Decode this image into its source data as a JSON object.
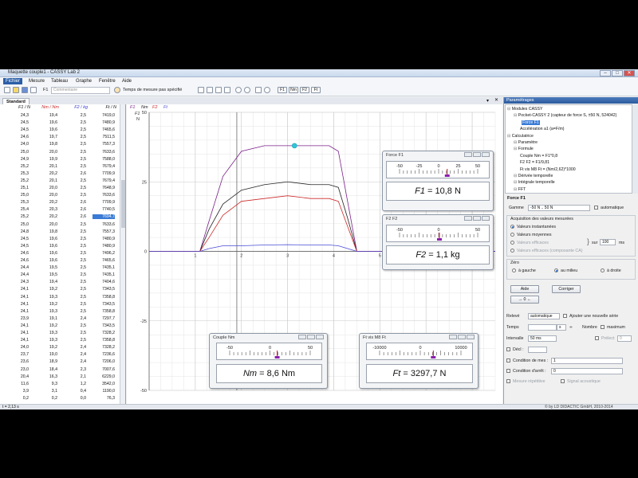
{
  "window": {
    "title": "Maquette couple1 - CASSY Lab 2",
    "min": "–",
    "max": "□",
    "close": "✕"
  },
  "menu": [
    "Fichier",
    "Mesure",
    "Tableau",
    "Graphe",
    "Fenêtre",
    "Aide"
  ],
  "toolbar": {
    "counter": "F1",
    "comment_placeholder": "Commentaire",
    "measure_time": "Temps de mesure pas spécifié",
    "quantity_buttons": [
      "F1",
      "Nm",
      "F2",
      "Ft"
    ]
  },
  "tab": "Standard",
  "table": {
    "headers": [
      "F1 / N",
      "Nm / Nm",
      "F2 / kg",
      "Ft / N"
    ],
    "rows": [
      [
        "24,3",
        "19,4",
        "2,5",
        "7419,0"
      ],
      [
        "24,5",
        "19,6",
        "2,5",
        "7480,9"
      ],
      [
        "24,5",
        "19,6",
        "2,5",
        "7465,6"
      ],
      [
        "24,6",
        "19,7",
        "2,5",
        "7511,5"
      ],
      [
        "24,0",
        "19,8",
        "2,5",
        "7557,3"
      ],
      [
        "25,0",
        "20,0",
        "2,5",
        "7633,6"
      ],
      [
        "24,9",
        "19,9",
        "2,5",
        "7588,0"
      ],
      [
        "25,2",
        "20,1",
        "2,5",
        "7679,4"
      ],
      [
        "25,3",
        "20,2",
        "2,6",
        "7709,9"
      ],
      [
        "25,2",
        "20,1",
        "2,5",
        "7679,4"
      ],
      [
        "25,1",
        "20,0",
        "2,5",
        "7648,9"
      ],
      [
        "25,0",
        "20,0",
        "2,5",
        "7633,6"
      ],
      [
        "25,3",
        "20,2",
        "2,6",
        "7709,9"
      ],
      [
        "25,4",
        "20,3",
        "2,6",
        "7740,5"
      ],
      [
        "25,2",
        "20,2",
        "2,6",
        "7694,7"
      ],
      [
        "25,0",
        "20,0",
        "2,5",
        "7633,6"
      ],
      [
        "24,8",
        "19,8",
        "2,5",
        "7557,3"
      ],
      [
        "24,5",
        "19,6",
        "2,5",
        "7480,9"
      ],
      [
        "24,5",
        "19,6",
        "2,5",
        "7480,9"
      ],
      [
        "24,6",
        "19,6",
        "2,5",
        "7496,2"
      ],
      [
        "24,6",
        "19,6",
        "2,5",
        "7465,6"
      ],
      [
        "24,4",
        "19,5",
        "2,5",
        "7435,1"
      ],
      [
        "24,4",
        "19,5",
        "2,5",
        "7435,1"
      ],
      [
        "24,3",
        "19,4",
        "2,5",
        "7404,6"
      ],
      [
        "24,1",
        "19,2",
        "2,5",
        "7343,5"
      ],
      [
        "24,1",
        "19,3",
        "2,5",
        "7358,8"
      ],
      [
        "24,1",
        "19,2",
        "2,5",
        "7343,5"
      ],
      [
        "24,1",
        "19,3",
        "2,5",
        "7358,8"
      ],
      [
        "23,9",
        "19,1",
        "2,4",
        "7297,7"
      ],
      [
        "24,1",
        "19,2",
        "2,5",
        "7343,5"
      ],
      [
        "24,1",
        "19,3",
        "2,5",
        "7328,2"
      ],
      [
        "24,1",
        "19,3",
        "2,5",
        "7358,8"
      ],
      [
        "24,0",
        "19,2",
        "2,4",
        "7328,2"
      ],
      [
        "23,7",
        "19,0",
        "2,4",
        "7236,6"
      ],
      [
        "23,6",
        "18,9",
        "2,4",
        "7206,0"
      ],
      [
        "23,0",
        "18,4",
        "2,3",
        "7007,6"
      ],
      [
        "20,4",
        "16,3",
        "2,1",
        "6229,0"
      ],
      [
        "11,6",
        "9,3",
        "1,2",
        "3542,0"
      ],
      [
        "3,9",
        "3,1",
        "0,4",
        "1190,0"
      ],
      [
        "0,2",
        "0,2",
        "0,0",
        "76,3"
      ]
    ],
    "selected_row": 14
  },
  "chart": {
    "legend": [
      "F1",
      "Nm",
      "F2",
      "Ft"
    ],
    "y_unit": "F1\nN",
    "x_unit": "t / s",
    "colors": {
      "F1": "#7b1f8a",
      "Nm": "#222222",
      "F2": "#cc2a2a",
      "Ft": "#4a4ad6"
    }
  },
  "chart_data": {
    "type": "line",
    "xlabel": "t / s",
    "ylabel": "F1 / N",
    "xlim": [
      0,
      7.5
    ],
    "ylim": [
      -50,
      50
    ],
    "x_ticks": [
      0,
      1,
      2,
      3,
      4,
      5,
      6,
      7
    ],
    "y_ticks": [
      -50,
      -25,
      0,
      25,
      50
    ],
    "grid": true,
    "legend": "top-left",
    "series": [
      {
        "name": "F1",
        "x": [
          0,
          1.1,
          1.3,
          1.6,
          2.0,
          2.5,
          3.0,
          3.5,
          3.9,
          4.1,
          4.3,
          4.5,
          7.5
        ],
        "y": [
          0,
          0,
          11,
          27,
          36,
          38,
          38,
          38,
          38,
          36,
          18,
          0,
          0
        ]
      },
      {
        "name": "Nm",
        "x": [
          0,
          1.1,
          1.3,
          1.6,
          2.0,
          2.5,
          3.0,
          3.5,
          3.9,
          4.1,
          4.3,
          4.5,
          7.5
        ],
        "y": [
          0,
          0,
          8,
          17,
          22,
          24,
          25,
          24,
          24,
          23,
          12,
          0,
          0
        ]
      },
      {
        "name": "F2",
        "x": [
          0,
          1.1,
          1.3,
          1.6,
          2.0,
          2.5,
          3.0,
          3.5,
          3.9,
          4.1,
          4.3,
          4.5,
          7.5
        ],
        "y": [
          0,
          0,
          5,
          13,
          18,
          19,
          20,
          19,
          19,
          18,
          9,
          0,
          0
        ]
      },
      {
        "name": "Ft",
        "x": [
          0,
          1.1,
          1.3,
          1.6,
          2.0,
          2.5,
          3.0,
          3.5,
          3.9,
          4.1,
          4.3,
          4.5,
          7.5
        ],
        "y": [
          0,
          0,
          1,
          2,
          2,
          2.3,
          2.4,
          2.3,
          2.3,
          2,
          1,
          0,
          0
        ]
      }
    ]
  },
  "instruments": [
    {
      "title": "Force F1",
      "ticks": [
        "-50",
        "-25",
        "0",
        "25",
        "50"
      ],
      "label": "F1",
      "value": "10,8 N",
      "needle": 0.61
    },
    {
      "title": "F2 F2",
      "ticks": [
        "-50",
        "0",
        "50"
      ],
      "label": "F2",
      "value": "1,1 kg",
      "needle": 0.51
    },
    {
      "title": "Couple Nm",
      "ticks": [
        "-50",
        "0",
        "50"
      ],
      "label": "Nm",
      "value": "8,6 Nm",
      "needle": 0.59
    },
    {
      "title": "Ft vis M8 Ft",
      "ticks": [
        "-10000",
        "0",
        "10000"
      ],
      "label": "Ft",
      "value": "3297,7 N",
      "needle": 0.66
    }
  ],
  "settings": {
    "header": "Paramétrages",
    "tree": [
      {
        "text": "Modules CASSY",
        "level": 1
      },
      {
        "text": "Pocket-CASSY 2 (capteur de force S, ±50 N, 524042)",
        "level": 2
      },
      {
        "text": "Force F1",
        "level": 3,
        "selected": true
      },
      {
        "text": "Accélération a1 (a=F/m)",
        "level": 3
      },
      {
        "text": "Calculatrice",
        "level": 1
      },
      {
        "text": "Paramètre",
        "level": 2
      },
      {
        "text": "Formule",
        "level": 2
      },
      {
        "text": "Couple Nm = F1*0,8",
        "level": 3
      },
      {
        "text": "F2 F2 = F1/9,81",
        "level": 3
      },
      {
        "text": "Ft vis M8 Ft = (Nm/2,62)*1000",
        "level": 3
      },
      {
        "text": "Dérivée temporelle",
        "level": 2
      },
      {
        "text": "Intégrale temporelle",
        "level": 2
      },
      {
        "text": "FFT",
        "level": 2
      }
    ],
    "props_title": "Force F1",
    "gamme_label": "Gamme",
    "gamme_value": "-50 N .. 50 N",
    "auto_label": "automatique",
    "acq_title": "Acquisition des valeurs mesurées",
    "acq_options": [
      "Valeurs instantanées",
      "Valeurs moyennes",
      "Valeurs efficaces",
      "Valeurs efficaces (composante CA)"
    ],
    "sur_label": "sur",
    "sur_value": "100",
    "ms_label": "ms",
    "zero_title": "Zéro",
    "zero_options": [
      "à gauche",
      "au milieu",
      "à droite"
    ],
    "btn_aide": "Aide",
    "btn_corriger": "Corriger",
    "btn_arrow": "→ 0 ←",
    "releve_label": "Relevé",
    "releve_value": "automatique",
    "add_series": "Ajouter une nouvelle série",
    "temps_label": "Temps",
    "temps_unit": "s",
    "nombre_label": "Nombre",
    "maximum_label": "maximum",
    "intervalle_label": "Intervalle",
    "intervalle_value": "50 ms",
    "prelect_label": "Prélect",
    "prelect_value": "0",
    "decl_label": "Décl :",
    "cond_mes_label": "Condition de mes :",
    "cond_mes_value": "1",
    "cond_arret_label": "Condition d'arrêt :",
    "cond_arret_value": "0",
    "mesure_rep": "Mesure répétitive",
    "signal_acoustique": "Signal acoustique"
  },
  "status": {
    "left": "t = 2,13 s",
    "right": "© by LD DIDACTIC GmbH, 2010-2014"
  }
}
